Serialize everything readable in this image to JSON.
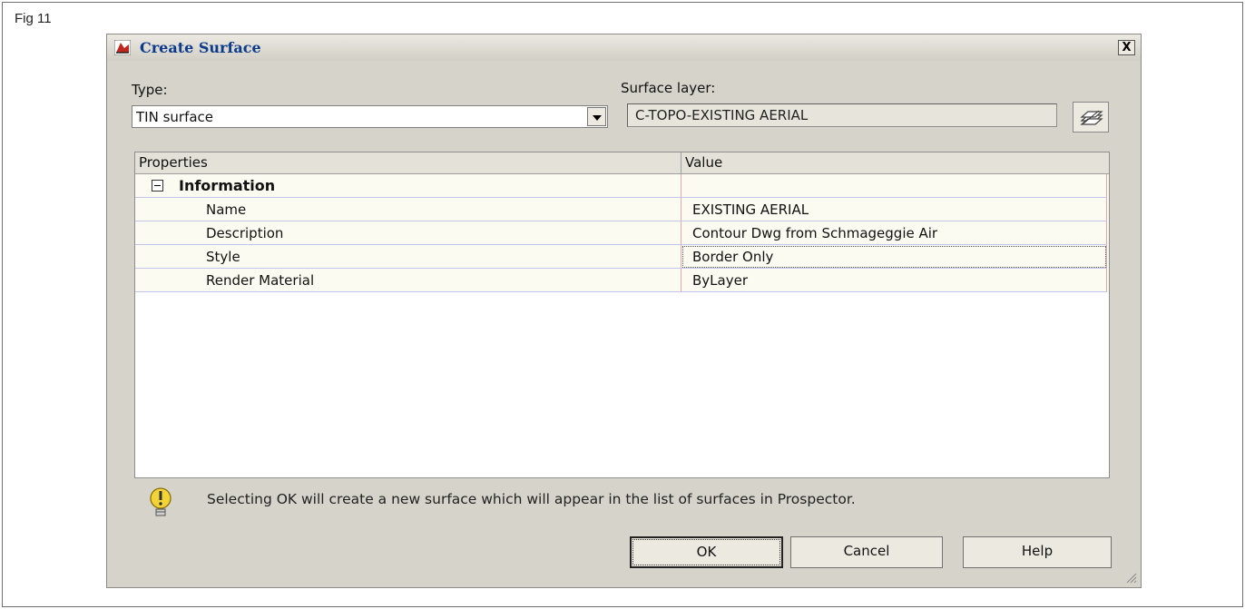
{
  "figure_label": "Fig 11",
  "dialog": {
    "title": "Create Surface",
    "close_label": "X"
  },
  "type": {
    "label": "Type:",
    "value": "TIN surface"
  },
  "surface_layer": {
    "label": "Surface layer:",
    "value": "C-TOPO-EXISTING AERIAL"
  },
  "grid": {
    "col_properties": "Properties",
    "col_value": "Value",
    "category": "Information",
    "rows": [
      {
        "property": "Name",
        "value": "EXISTING AERIAL"
      },
      {
        "property": "Description",
        "value": "Contour Dwg from Schmageggie Air"
      },
      {
        "property": "Style",
        "value": "Border Only"
      },
      {
        "property": "Render Material",
        "value": "ByLayer"
      }
    ]
  },
  "hint": "Selecting OK will create a new surface which will appear in the list of surfaces in Prospector.",
  "buttons": {
    "ok": "OK",
    "cancel": "Cancel",
    "help": "Help"
  },
  "colors": {
    "dialog_bg": "#d6d3cb",
    "title_text": "#0c3b8c",
    "grid_row_bg": "#fbfbf2"
  }
}
